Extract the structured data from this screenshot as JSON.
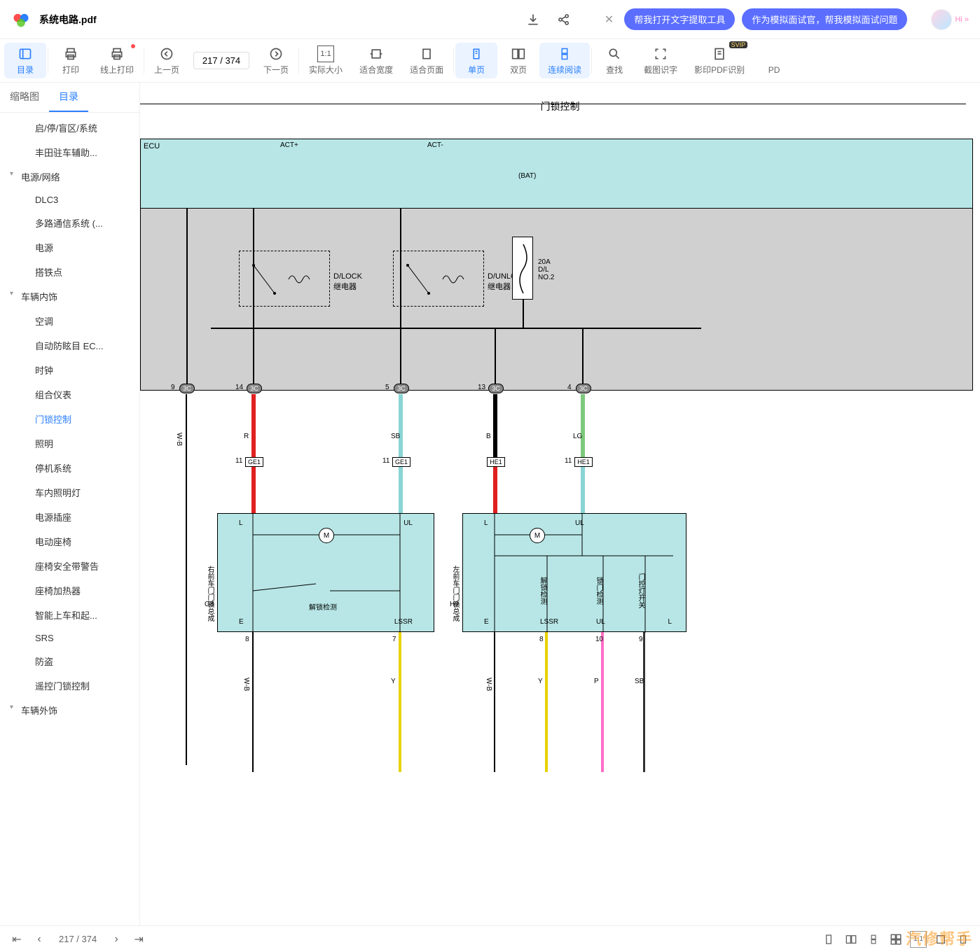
{
  "header": {
    "file_title": "系统电路.pdf",
    "ai_btn1": "帮我打开文字提取工具",
    "ai_btn2": "作为模拟面试官，帮我模拟面试问题",
    "hi": "Hi »"
  },
  "toolbar": {
    "items": [
      {
        "label": "目录",
        "icon": "list",
        "active": true
      },
      {
        "label": "打印",
        "icon": "print"
      },
      {
        "label": "线上打印",
        "icon": "print-online",
        "dot": true
      },
      {
        "label": "上一页",
        "icon": "prev"
      },
      {
        "label": "下一页",
        "icon": "next"
      },
      {
        "label": "实际大小",
        "icon": "1:1"
      },
      {
        "label": "适合宽度",
        "icon": "fit-w"
      },
      {
        "label": "适合页面",
        "icon": "fit-p"
      },
      {
        "label": "单页",
        "icon": "single",
        "active": true
      },
      {
        "label": "双页",
        "icon": "double"
      },
      {
        "label": "连续阅读",
        "icon": "cont",
        "active": true
      },
      {
        "label": "查找",
        "icon": "search"
      },
      {
        "label": "截图识字",
        "icon": "crop"
      },
      {
        "label": "影印PDF识别",
        "icon": "ocr",
        "svip": true
      },
      {
        "label": "PD",
        "icon": "pd"
      }
    ],
    "page_input": "217 / 374"
  },
  "sidebar": {
    "tabs": {
      "thumb": "缩略图",
      "toc": "目录"
    },
    "tree": [
      {
        "type": "leaf",
        "label": "启/停/盲区/系统"
      },
      {
        "type": "leaf",
        "label": "丰田驻车辅助..."
      },
      {
        "type": "group",
        "label": "电源/网络"
      },
      {
        "type": "leaf",
        "label": "DLC3"
      },
      {
        "type": "leaf",
        "label": "多路通信系统 (..."
      },
      {
        "type": "leaf",
        "label": "电源"
      },
      {
        "type": "leaf",
        "label": "搭铁点"
      },
      {
        "type": "group",
        "label": "车辆内饰"
      },
      {
        "type": "leaf",
        "label": "空调"
      },
      {
        "type": "leaf",
        "label": "自动防眩目 EC..."
      },
      {
        "type": "leaf",
        "label": "时钟"
      },
      {
        "type": "leaf",
        "label": "组合仪表"
      },
      {
        "type": "leaf",
        "label": "门锁控制",
        "active": true
      },
      {
        "type": "leaf",
        "label": "照明"
      },
      {
        "type": "leaf",
        "label": "停机系统"
      },
      {
        "type": "leaf",
        "label": "车内照明灯"
      },
      {
        "type": "leaf",
        "label": "电源插座"
      },
      {
        "type": "leaf",
        "label": "电动座椅"
      },
      {
        "type": "leaf",
        "label": "座椅安全带警告"
      },
      {
        "type": "leaf",
        "label": "座椅加热器"
      },
      {
        "type": "leaf",
        "label": "智能上车和起..."
      },
      {
        "type": "leaf",
        "label": "SRS"
      },
      {
        "type": "leaf",
        "label": "防盗"
      },
      {
        "type": "leaf",
        "label": "遥控门锁控制"
      },
      {
        "type": "group",
        "label": "车辆外饰"
      }
    ]
  },
  "diagram": {
    "title": "门锁控制",
    "ecu": "ECU",
    "act_plus": "ACT+",
    "act_minus": "ACT-",
    "bat": "(BAT)",
    "relay1": "D/LOCK\n继电器",
    "relay2": "D/UNLOCK\n继电器",
    "fuse": "20A\nD/L\nNO.2",
    "junctions": [
      "GE1",
      "GE1",
      "HE1",
      "HE1"
    ],
    "motor_left_title": "右前车门门锁总成",
    "motor_right_title": "左前车门门锁总成",
    "detect_left": "解锁检测",
    "detect_right1": "解锁检测",
    "detect_right2": "锁门检测",
    "detect_right3": "门控灯开关",
    "pins": {
      "L": "L",
      "UL": "UL",
      "E": "E",
      "LSSR": "LSSR"
    },
    "conn_nums": {
      "c1": "9",
      "c2": "14",
      "c3": "5",
      "c4": "13",
      "c5": "4",
      "c6": "11",
      "c7": "11",
      "c8": "11",
      "c9": "G8",
      "c10": "H9",
      "c11": "8",
      "c12": "7",
      "c13": "8",
      "c14": "10"
    },
    "wire_labels": {
      "wb": "W-B",
      "r": "R",
      "sb": "SB",
      "b": "B",
      "lg": "LG",
      "y": "Y",
      "p": "P"
    }
  },
  "bottom": {
    "page": "217 / 374"
  },
  "watermark": "汽修帮手"
}
